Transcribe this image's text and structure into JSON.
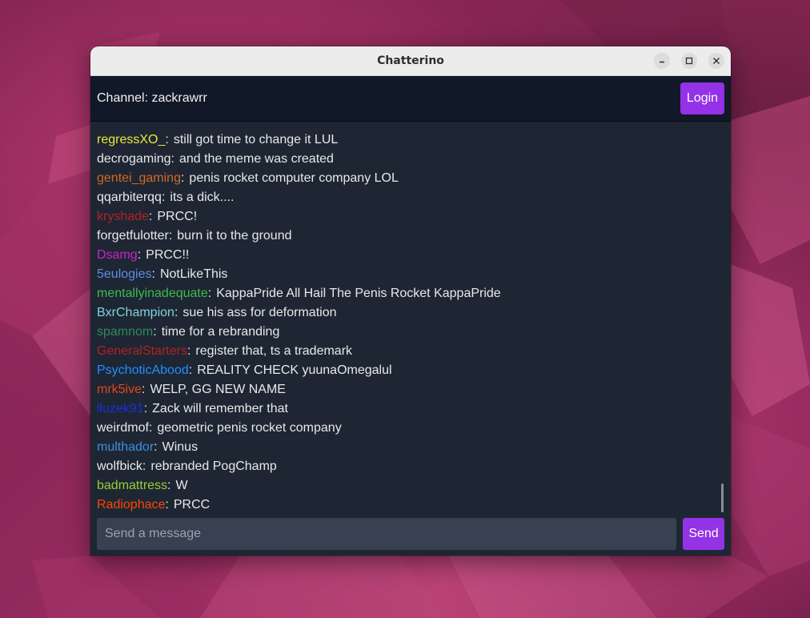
{
  "window": {
    "title": "Chatterino",
    "controls": {
      "minimize": "minimize-icon",
      "maximize": "maximize-icon",
      "close": "close-icon"
    }
  },
  "header": {
    "channel_label": "Channel: zackrawrr",
    "login_label": "Login"
  },
  "messages": [
    {
      "user": "regressXO_",
      "color": "#e8e83a",
      "text": "still got time to change it LUL"
    },
    {
      "user": "decrogaming",
      "color": "#e8e8e8",
      "text": "and the meme was created"
    },
    {
      "user": "gentei_gaming",
      "color": "#d2691e",
      "text": "penis rocket computer company LOL"
    },
    {
      "user": "qqarbiterqq",
      "color": "#e8e8e8",
      "text": "its a dick...."
    },
    {
      "user": "kryshade",
      "color": "#b22222",
      "text": "PRCC!"
    },
    {
      "user": "forgetfulotter",
      "color": "#e8e8e8",
      "text": "burn it to the ground"
    },
    {
      "user": "Dsamg",
      "color": "#cc22cc",
      "text": "PRCC!!"
    },
    {
      "user": "5eulogies",
      "color": "#5b8de0",
      "text": "NotLikeThis"
    },
    {
      "user": "mentallyinadequate",
      "color": "#3cbc4c",
      "text": "KappaPride All Hail The Penis Rocket KappaPride"
    },
    {
      "user": "BxrChampion",
      "color": "#7fd4d8",
      "text": "sue his ass for deformation"
    },
    {
      "user": "spamnom",
      "color": "#2e8b57",
      "text": "time for a rebranding"
    },
    {
      "user": "GeneralStarters",
      "color": "#b22222",
      "text": "register that, ts a trademark"
    },
    {
      "user": "PsychoticAbood",
      "color": "#1e90ff",
      "text": "REALITY CHECK yuunaOmegalul"
    },
    {
      "user": "mrk5ive",
      "color": "#e0471c",
      "text": "WELP, GG NEW NAME"
    },
    {
      "user": "lluzek91",
      "color": "#1c2cd8",
      "text": "Zack will remember that"
    },
    {
      "user": "weirdmof",
      "color": "#e8e8e8",
      "text": "geometric penis rocket company"
    },
    {
      "user": "multhador",
      "color": "#3a8fe0",
      "text": "Winus"
    },
    {
      "user": "wolfbick",
      "color": "#e8e8e8",
      "text": "rebranded PogChamp"
    },
    {
      "user": "badmattress",
      "color": "#9acd32",
      "text": "W"
    },
    {
      "user": "Radiophace",
      "color": "#ff4500",
      "text": "PRCC"
    }
  ],
  "composer": {
    "placeholder": "Send a message",
    "value": "",
    "send_label": "Send"
  },
  "colors": {
    "accent": "#9332e6",
    "chat_background": "#1e2634",
    "header_background": "#111827",
    "input_background": "#374151"
  }
}
